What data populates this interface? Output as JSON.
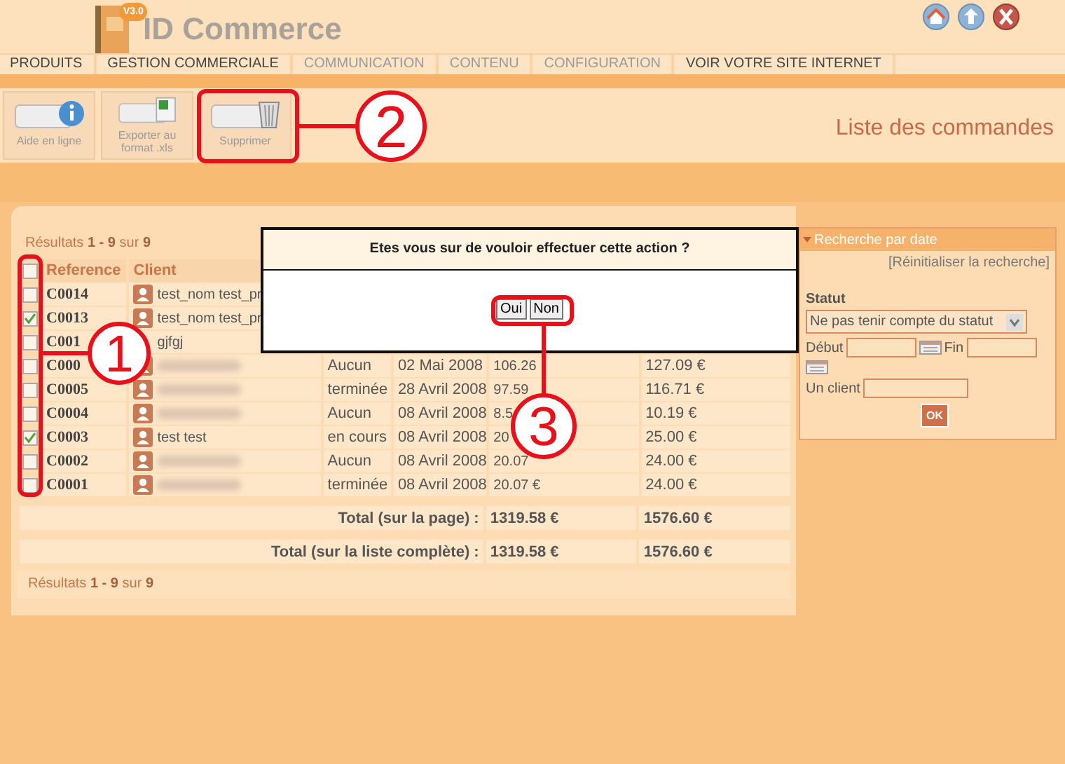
{
  "header": {
    "version": "V3.0",
    "brand": "ID Commerce"
  },
  "nav": [
    {
      "label": "PRODUITS",
      "dimmed": false
    },
    {
      "label": "GESTION COMMERCIALE",
      "dimmed": false
    },
    {
      "label": "COMMUNICATION",
      "dimmed": true
    },
    {
      "label": "CONTENU",
      "dimmed": true
    },
    {
      "label": "CONFIGURATION",
      "dimmed": true
    },
    {
      "label": "VOIR VOTRE SITE INTERNET",
      "dimmed": false
    }
  ],
  "toolbar": {
    "buttons": [
      {
        "label": "Aide en ligne",
        "kind": "info"
      },
      {
        "label": "Exporter au format .xls",
        "kind": "excel"
      },
      {
        "label": "Supprimer",
        "kind": "trash"
      }
    ],
    "title": "Liste des commandes"
  },
  "results_top": "Résultats **1 - 9** sur **9**",
  "table": {
    "columns": [
      "Reference",
      "Client"
    ],
    "header_checked": false,
    "rows": [
      {
        "checked": false,
        "reference": "C0014",
        "client": "test_nom test_pr",
        "client_icon": true,
        "blurred": false
      },
      {
        "checked": true,
        "reference": "C0013",
        "client": "test_nom test_pr",
        "client_icon": true,
        "blurred": false
      },
      {
        "checked": false,
        "reference": "C001",
        "client": "gjfgj",
        "client_icon": false,
        "blurred": false
      },
      {
        "checked": false,
        "reference": "C000",
        "client_icon": true,
        "blurred": true,
        "status": "Aucun",
        "date": "02 Mai 2008",
        "amount": "106.26",
        "amount_2": "127.09 €"
      },
      {
        "checked": false,
        "reference": "C0005",
        "client_icon": true,
        "blurred": true,
        "status": "terminée",
        "date": "28 Avril 2008",
        "amount": "97.59",
        "amount_2": "116.71 €"
      },
      {
        "checked": false,
        "reference": "C0004",
        "client_icon": true,
        "blurred": true,
        "status": "Aucun",
        "date": "08 Avril 2008",
        "amount": "8.5",
        "amount_2": "10.19 €"
      },
      {
        "checked": true,
        "reference": "C0003",
        "client": "test test",
        "client_icon": true,
        "blurred": false,
        "status": "en cours",
        "date": "08 Avril 2008",
        "amount": "20",
        "amount_2": "25.00 €"
      },
      {
        "checked": false,
        "reference": "C0002",
        "client_icon": true,
        "blurred": true,
        "status": "Aucun",
        "date": "08 Avril 2008",
        "amount": "20.07",
        "amount_2": "24.00 €"
      },
      {
        "checked": false,
        "reference": "C0001",
        "client_icon": true,
        "blurred": true,
        "status": "terminée",
        "date": "08 Avril 2008",
        "amount": "20.07 €",
        "amount_2": "24.00 €"
      }
    ]
  },
  "totals": [
    {
      "label": "Total (sur la page) :",
      "amount": "1319.58 €",
      "amount_2": "1576.60 €"
    },
    {
      "label": "Total (sur la liste complète) :",
      "amount": "1319.58 €",
      "amount_2": "1576.60 €"
    }
  ],
  "results_bottom": "Résultats **1 - 9** sur **9**",
  "dialog": {
    "message": "Etes vous sur de vouloir effectuer cette action ?",
    "buttons": [
      "Oui",
      "Non"
    ]
  },
  "search": {
    "title": "Recherche par date",
    "expanded": true,
    "reset": "[Réinitialiser la recherche]",
    "status_label": "Statut",
    "status_value": "Ne pas tenir compte du statut",
    "start_label": "Début",
    "end_label": "Fin",
    "client_label": "Un client",
    "submit": "OK"
  },
  "callouts": [
    {
      "number": "1"
    },
    {
      "number": "2"
    },
    {
      "number": "3"
    }
  ]
}
